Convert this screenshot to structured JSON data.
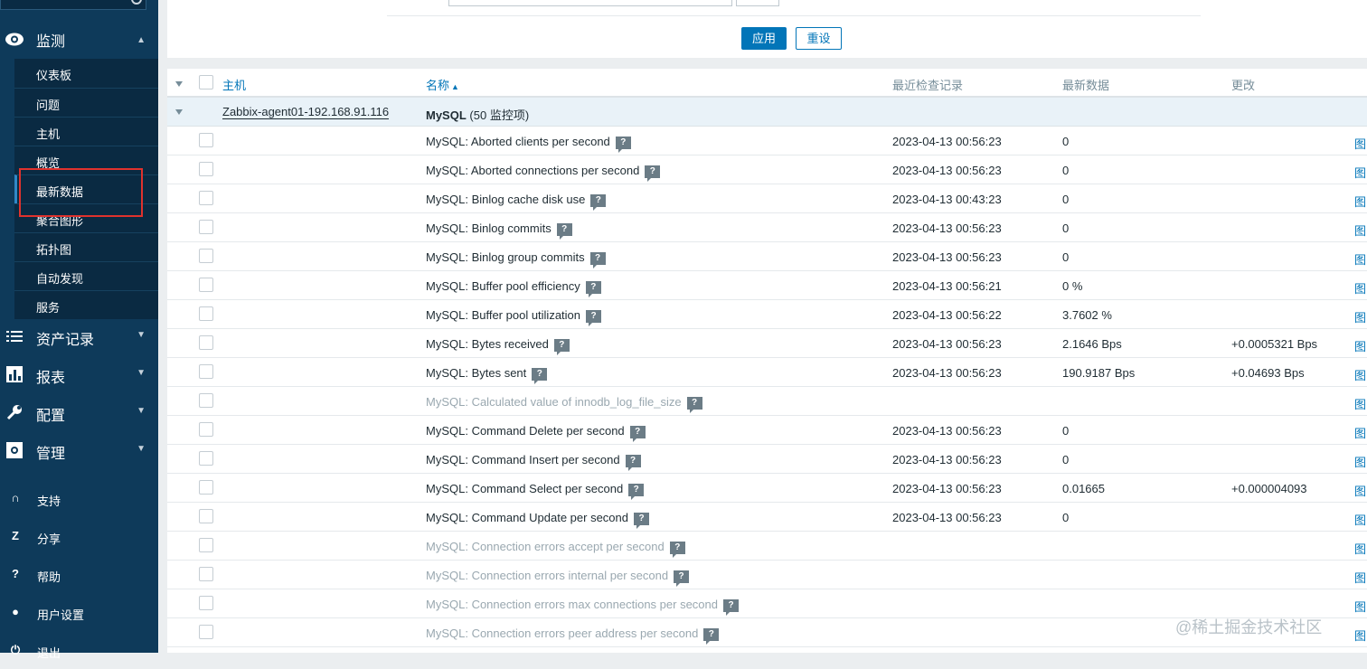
{
  "sidebar": {
    "monitor_label": "监测",
    "monitor_items": [
      {
        "label": "仪表板"
      },
      {
        "label": "问题"
      },
      {
        "label": "主机"
      },
      {
        "label": "概览"
      },
      {
        "label": "最新数据"
      },
      {
        "label": "聚合图形"
      },
      {
        "label": "拓扑图"
      },
      {
        "label": "自动发现"
      },
      {
        "label": "服务"
      }
    ],
    "groups": [
      {
        "label": "资产记录"
      },
      {
        "label": "报表"
      },
      {
        "label": "配置"
      },
      {
        "label": "管理"
      }
    ],
    "footer": [
      {
        "label": "支持",
        "icon": "headset-icon"
      },
      {
        "label": "分享",
        "icon": "share-icon"
      },
      {
        "label": "帮助",
        "icon": "help-icon"
      },
      {
        "label": "用户设置",
        "icon": "user-icon"
      },
      {
        "label": "退出",
        "icon": "power-icon"
      }
    ]
  },
  "filter": {
    "apply_label": "应用",
    "reset_label": "重设"
  },
  "table": {
    "headers": {
      "host": "主机",
      "name": "名称",
      "last_check": "最近检查记录",
      "last_value": "最新数据",
      "change": "更改"
    },
    "group": {
      "host": "Zabbix-agent01-192.168.91.116",
      "app": "MySQL",
      "count": "(50 监控项)"
    },
    "rows": [
      {
        "name": "MySQL: Aborted clients per second",
        "time": "2023-04-13 00:56:23",
        "value": "0",
        "change": "",
        "graph": "图",
        "disabled": false
      },
      {
        "name": "MySQL: Aborted connections per second",
        "time": "2023-04-13 00:56:23",
        "value": "0",
        "change": "",
        "graph": "图",
        "disabled": false
      },
      {
        "name": "MySQL: Binlog cache disk use",
        "time": "2023-04-13 00:43:23",
        "value": "0",
        "change": "",
        "graph": "图",
        "disabled": false
      },
      {
        "name": "MySQL: Binlog commits",
        "time": "2023-04-13 00:56:23",
        "value": "0",
        "change": "",
        "graph": "图",
        "disabled": false
      },
      {
        "name": "MySQL: Binlog group commits",
        "time": "2023-04-13 00:56:23",
        "value": "0",
        "change": "",
        "graph": "图",
        "disabled": false
      },
      {
        "name": "MySQL: Buffer pool efficiency",
        "time": "2023-04-13 00:56:21",
        "value": "0 %",
        "change": "",
        "graph": "图",
        "disabled": false
      },
      {
        "name": "MySQL: Buffer pool utilization",
        "time": "2023-04-13 00:56:22",
        "value": "3.7602 %",
        "change": "",
        "graph": "图",
        "disabled": false
      },
      {
        "name": "MySQL: Bytes received",
        "time": "2023-04-13 00:56:23",
        "value": "2.1646 Bps",
        "change": "+0.0005321 Bps",
        "graph": "图",
        "disabled": false
      },
      {
        "name": "MySQL: Bytes sent",
        "time": "2023-04-13 00:56:23",
        "value": "190.9187 Bps",
        "change": "+0.04693 Bps",
        "graph": "图",
        "disabled": false
      },
      {
        "name": "MySQL: Calculated value of innodb_log_file_size",
        "time": "",
        "value": "",
        "change": "",
        "graph": "图",
        "disabled": true
      },
      {
        "name": "MySQL: Command Delete per second",
        "time": "2023-04-13 00:56:23",
        "value": "0",
        "change": "",
        "graph": "图",
        "disabled": false
      },
      {
        "name": "MySQL: Command Insert per second",
        "time": "2023-04-13 00:56:23",
        "value": "0",
        "change": "",
        "graph": "图",
        "disabled": false
      },
      {
        "name": "MySQL: Command Select per second",
        "time": "2023-04-13 00:56:23",
        "value": "0.01665",
        "change": "+0.000004093",
        "graph": "图",
        "disabled": false
      },
      {
        "name": "MySQL: Command Update per second",
        "time": "2023-04-13 00:56:23",
        "value": "0",
        "change": "",
        "graph": "图",
        "disabled": false
      },
      {
        "name": "MySQL: Connection errors accept per second",
        "time": "",
        "value": "",
        "change": "",
        "graph": "图",
        "disabled": true
      },
      {
        "name": "MySQL: Connection errors internal per second",
        "time": "",
        "value": "",
        "change": "",
        "graph": "图",
        "disabled": true
      },
      {
        "name": "MySQL: Connection errors max connections per second",
        "time": "",
        "value": "",
        "change": "",
        "graph": "图",
        "disabled": true
      },
      {
        "name": "MySQL: Connection errors peer address per second",
        "time": "",
        "value": "",
        "change": "",
        "graph": "图",
        "disabled": true
      }
    ]
  },
  "watermark": "@稀土掘金技术社区",
  "colors": {
    "sidebar_bg": "#0e3a5a",
    "accent": "#0275b8",
    "highlight_box": "#e0322d"
  }
}
